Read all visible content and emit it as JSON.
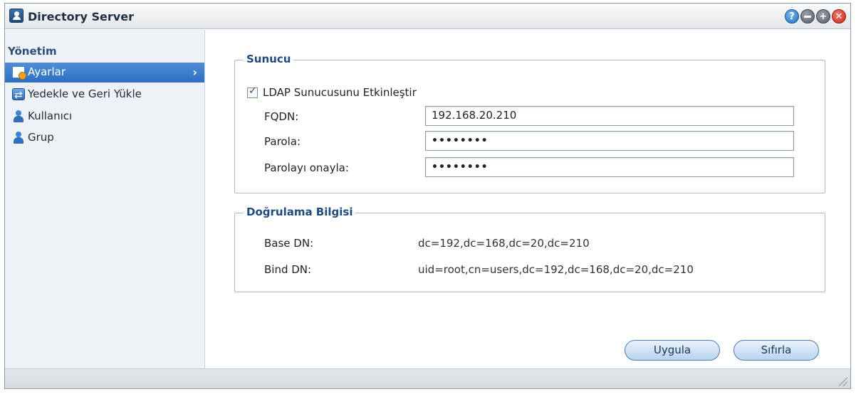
{
  "window": {
    "title": "Directory Server"
  },
  "title_buttons": {
    "help": "?",
    "maximize": "+",
    "close": "✕"
  },
  "sidebar": {
    "heading": "Yönetim",
    "items": [
      {
        "label": "Ayarlar",
        "icon": "settings-icon",
        "active": true
      },
      {
        "label": "Yedekle ve Geri Yükle",
        "icon": "backup-restore-icon",
        "active": false
      },
      {
        "label": "Kullanıcı",
        "icon": "user-icon",
        "active": false
      },
      {
        "label": "Grup",
        "icon": "group-icon",
        "active": false
      }
    ],
    "active_chevron": "›"
  },
  "server": {
    "legend": "Sunucu",
    "enable_label": "LDAP Sunucusunu Etkinleştir",
    "enable_checked": true,
    "fqdn_label": "FQDN:",
    "fqdn_value": "192.168.20.210",
    "password_label": "Parola:",
    "password_value": "••••••••",
    "confirm_label": "Parolayı onayla:",
    "confirm_value": "••••••••"
  },
  "auth": {
    "legend": "Doğrulama Bilgisi",
    "base_dn_label": "Base DN:",
    "base_dn_value": "dc=192,dc=168,dc=20,dc=210",
    "bind_dn_label": "Bind DN:",
    "bind_dn_value": "uid=root,cn=users,dc=192,dc=168,dc=20,dc=210"
  },
  "buttons": {
    "apply": "Uygula",
    "reset": "Sıfırla"
  },
  "colors": {
    "accent": "#2d6fbf",
    "legend_text": "#1e4a7d"
  }
}
